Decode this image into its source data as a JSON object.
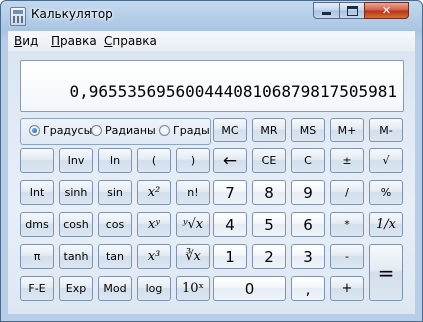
{
  "window": {
    "title": "Калькулятор"
  },
  "menu": [
    "Вид",
    "Правка",
    "Справка"
  ],
  "display": {
    "value": "0,96553569560044408106879817505981"
  },
  "angle_mode": {
    "options": [
      "Градусы",
      "Радианы",
      "Грады"
    ],
    "selected": "Градусы"
  },
  "buttons": {
    "memory": [
      "MC",
      "MR",
      "MS",
      "M+",
      "M-"
    ],
    "row2": [
      "",
      "Inv",
      "In",
      "(",
      ")",
      "←",
      "CE",
      "C",
      "±",
      "√"
    ],
    "row3": [
      "Int",
      "sinh",
      "sin",
      "x²",
      "n!",
      "7",
      "8",
      "9",
      "/",
      "%"
    ],
    "row4": [
      "dms",
      "cosh",
      "cos",
      "xʸ",
      "ʸ√x",
      "4",
      "5",
      "6",
      "*",
      "1/x"
    ],
    "row5": [
      "π",
      "tanh",
      "tan",
      "x³",
      "∛x",
      "1",
      "2",
      "3",
      "-",
      "="
    ],
    "row6": [
      "F-E",
      "Exp",
      "Mod",
      "log",
      "10ˣ",
      "0",
      ",",
      "+"
    ]
  }
}
